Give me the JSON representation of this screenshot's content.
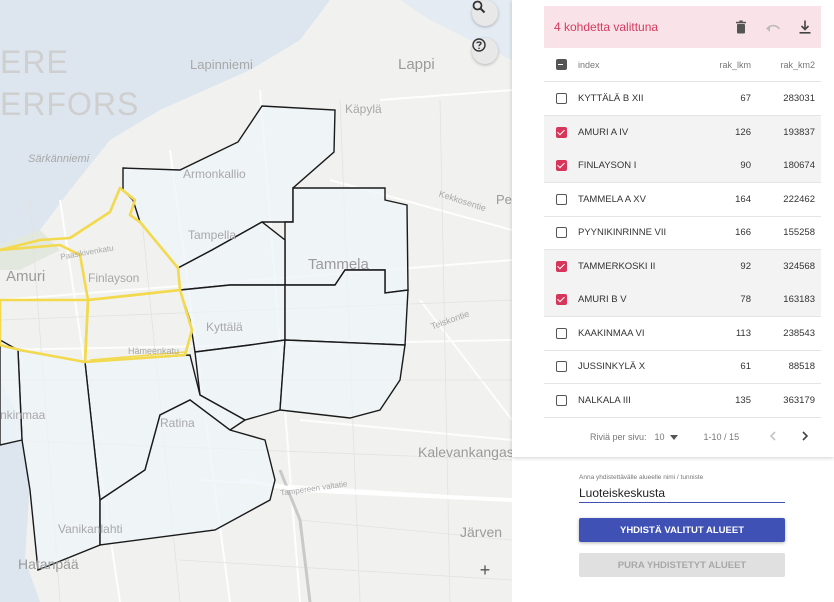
{
  "map": {
    "labels": {
      "ere": "ERE",
      "erfors": "ERFORS",
      "lapinniemi": "Lapinniemi",
      "lappi": "Lappi",
      "kapyla": "Käpylä",
      "sarkanniemi": "Särkänniemi",
      "armonkallio": "Armonkallio",
      "amuri": "Amuri",
      "finlayson": "Finlayson",
      "tammela": "Tammela",
      "tampella": "Tampella",
      "kyttala": "Kyttälä",
      "hameenkatu": "Hämeenkatu",
      "kalevankangas": "Kalevankangas",
      "jarvensivu": "Järven",
      "vanikanlahti": "Vanikanlahti",
      "hatanpaa": "Hatanpää",
      "ratina": "Ratina",
      "kekkosentie": "Kekkosentie",
      "pe": "Pe",
      "teiskontie": "Teiskontie",
      "paasikivenkatu": "Paasikivenkatu",
      "tampereen_valtatie": "Tampereen valtatie",
      "nkinmaa": "nkinmaa"
    },
    "zoom_in_symbol": "+"
  },
  "toolbar": {
    "selection_text": "4 kohdetta valittuna",
    "icons": [
      "delete-icon",
      "undo-icon",
      "download-icon"
    ]
  },
  "table": {
    "columns": {
      "index": "index",
      "rak_lkm": "rak_lkm",
      "rak_km2": "rak_km2"
    },
    "rows": [
      {
        "index": "KYTTÄLÄ B XII",
        "rak_lkm": "67",
        "rak_km2": "283031",
        "selected": false
      },
      {
        "index": "AMURI A IV",
        "rak_lkm": "126",
        "rak_km2": "193837",
        "selected": true
      },
      {
        "index": "FINLAYSON I",
        "rak_lkm": "90",
        "rak_km2": "180674",
        "selected": true
      },
      {
        "index": "TAMMELA A XV",
        "rak_lkm": "164",
        "rak_km2": "222462",
        "selected": false
      },
      {
        "index": "PYYNIKINRINNE VII",
        "rak_lkm": "166",
        "rak_km2": "155258",
        "selected": false
      },
      {
        "index": "TAMMERKOSKI II",
        "rak_lkm": "92",
        "rak_km2": "324568",
        "selected": true
      },
      {
        "index": "AMURI B V",
        "rak_lkm": "78",
        "rak_km2": "163183",
        "selected": true
      },
      {
        "index": "KAAKINMAA VI",
        "rak_lkm": "113",
        "rak_km2": "238543",
        "selected": false
      },
      {
        "index": "JUSSINKYLÄ X",
        "rak_lkm": "61",
        "rak_km2": "88518",
        "selected": false
      },
      {
        "index": "NALKALA III",
        "rak_lkm": "135",
        "rak_km2": "363179",
        "selected": false
      }
    ],
    "pager": {
      "rows_per_page_label": "Riviä per sivu:",
      "rows_per_page_value": "10",
      "range": "1-10 / 15"
    }
  },
  "form": {
    "name_label": "Anna yhdistettävälle alueelle nimi / tunniste",
    "name_value": "Luoteiskeskusta",
    "merge_button": "YHDISTÄ VALITUT ALUEET",
    "unmerge_button": "PURA YHDISTETYT ALUEET"
  },
  "colors": {
    "selection_bg": "#fae3e8",
    "selection_text": "#d53a5e",
    "checkbox_checked": "#d7355a",
    "primary_button": "#3f51b5",
    "highlight_outline": "#f2d94e",
    "area_outline": "#1a1a1a",
    "area_fill": "#eef4fa"
  }
}
